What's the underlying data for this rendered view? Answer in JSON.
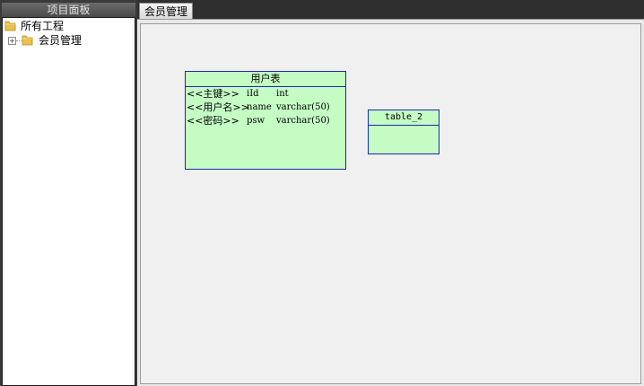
{
  "left_panel": {
    "title": "项目面板",
    "tree": {
      "root_label": "所有工程",
      "children": [
        {
          "label": "会员管理",
          "expander": "+"
        }
      ]
    }
  },
  "tabs": [
    {
      "label": "会员管理"
    }
  ],
  "colors": {
    "entity_fill": "#c4fcc4",
    "entity_border": "#1a2ca8",
    "canvas": "#f0f0f0"
  },
  "diagram": {
    "entities": [
      {
        "title": "用户表",
        "fields": [
          {
            "key": "<<主键>>",
            "name": "iId",
            "type": "int"
          },
          {
            "key": "<<用户名>>",
            "name": "name",
            "type": "varchar(50)"
          },
          {
            "key": "<<密码>>",
            "name": "psw",
            "type": "varchar(50)"
          }
        ]
      },
      {
        "title": "table_2",
        "fields": []
      }
    ]
  }
}
